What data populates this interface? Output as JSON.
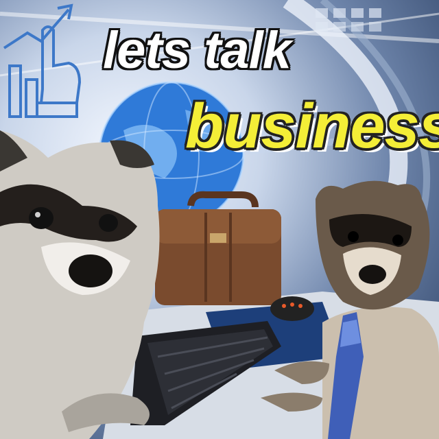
{
  "caption": {
    "line1": "lets talk",
    "line2": "business"
  },
  "colors": {
    "caption_white": "#ffffff",
    "caption_yellow": "#f4ee37",
    "globe_blue": "#2f7ad8",
    "briefcase_brown": "#7a4b2e",
    "tie_blue": "#3f5fb8"
  },
  "icons": [
    "growth-chart-icon",
    "pointing-hand-icon"
  ]
}
